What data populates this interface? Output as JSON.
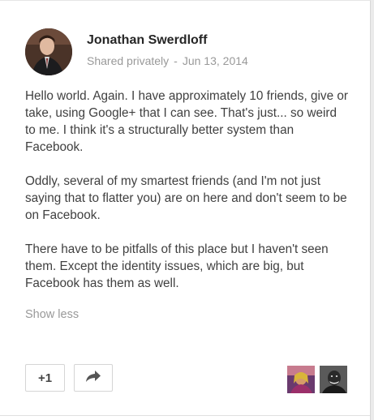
{
  "post": {
    "author": "Jonathan Swerdloff",
    "visibility": "Shared privately",
    "separator": "-",
    "date": "Jun 13, 2014",
    "paragraphs": [
      "Hello world.  Again.  I have approximately 10 friends, give or take, using Google+ that I can see.  That's just... so weird to me.  I think it's a structurally better system than Facebook.",
      "Oddly, several of my smartest friends (and I'm not just saying that to flatter you) are on here and don't seem to be on Facebook.",
      "There have to be pitfalls of this place but I haven't seen them.  Except the identity issues, which are big, but Facebook has them as well."
    ],
    "show_less": "Show less"
  },
  "actions": {
    "plus_one": "+1",
    "share_icon": "share-arrow-icon"
  },
  "plus_oners": [
    {
      "name": "plus-oner-avatar-1"
    },
    {
      "name": "plus-oner-avatar-2"
    }
  ],
  "colors": {
    "author": "#262626",
    "meta": "#999999",
    "body_text": "#404040",
    "background": "#ebebeb",
    "card": "#ffffff"
  }
}
